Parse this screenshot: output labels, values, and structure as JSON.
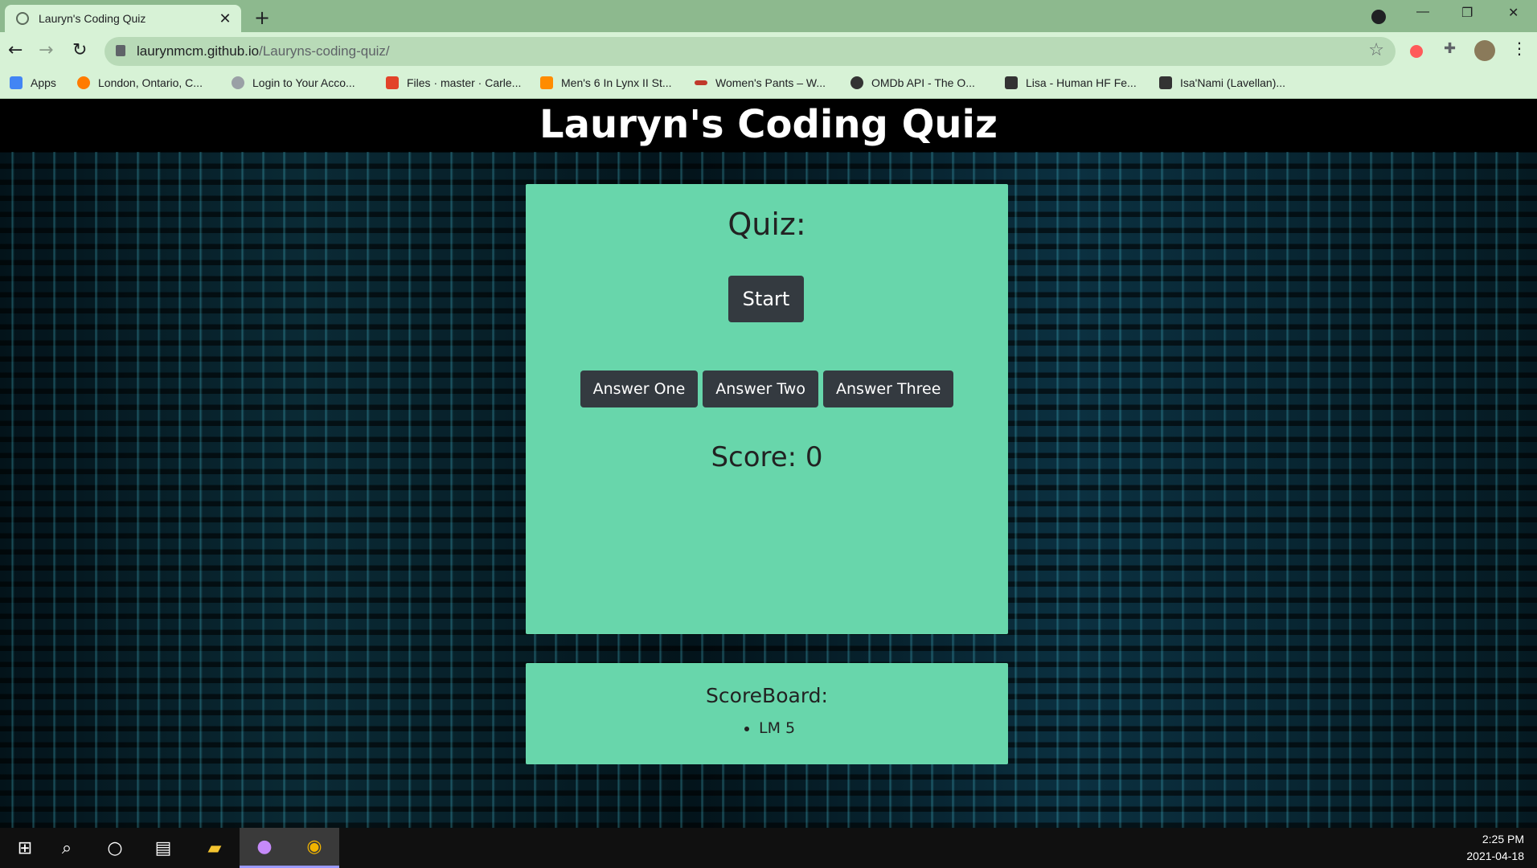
{
  "browser": {
    "tab_title": "Lauryn's Coding Quiz",
    "url_host": "laurynmcm.github.io",
    "url_path": "/Lauryns-coding-quiz/",
    "bookmarks": [
      {
        "label": "Apps",
        "icon": "apps-grid-icon",
        "color": "#4285f4"
      },
      {
        "label": "London, Ontario, C...",
        "icon": "weather-icon",
        "color": "#ff7b00"
      },
      {
        "label": "Login to Your Acco...",
        "icon": "globe-icon",
        "color": "#9aa0a6"
      },
      {
        "label": "Files · master · Carle...",
        "icon": "gitlab-icon",
        "color": "#e24329"
      },
      {
        "label": "Men's 6 In Lynx II St...",
        "icon": "square-icon",
        "color": "#ff8c00"
      },
      {
        "label": "Women's Pants – W...",
        "icon": "brand-icon",
        "color": "#c0392b"
      },
      {
        "label": "OMDb API - The O...",
        "icon": "film-icon",
        "color": "#333333"
      },
      {
        "label": "Lisa - Human HF Fe...",
        "icon": "butterfly-icon",
        "color": "#333333"
      },
      {
        "label": "Isa'Nami (Lavellan)...",
        "icon": "butterfly-icon",
        "color": "#333333"
      }
    ]
  },
  "page": {
    "title": "Lauryn's Coding Quiz",
    "quiz_heading": "Quiz:",
    "start_label": "Start",
    "answers": [
      "Answer One",
      "Answer Two",
      "Answer Three"
    ],
    "score_text": "Score: 0",
    "scoreboard_heading": "ScoreBoard:",
    "scoreboard_entries": [
      "LM 5"
    ]
  },
  "taskbar": {
    "time": "2:25 PM",
    "date": "2021-04-18"
  },
  "colors": {
    "card": "#68d6ab",
    "button": "#343a40",
    "chrome": "#d7f2d6"
  }
}
